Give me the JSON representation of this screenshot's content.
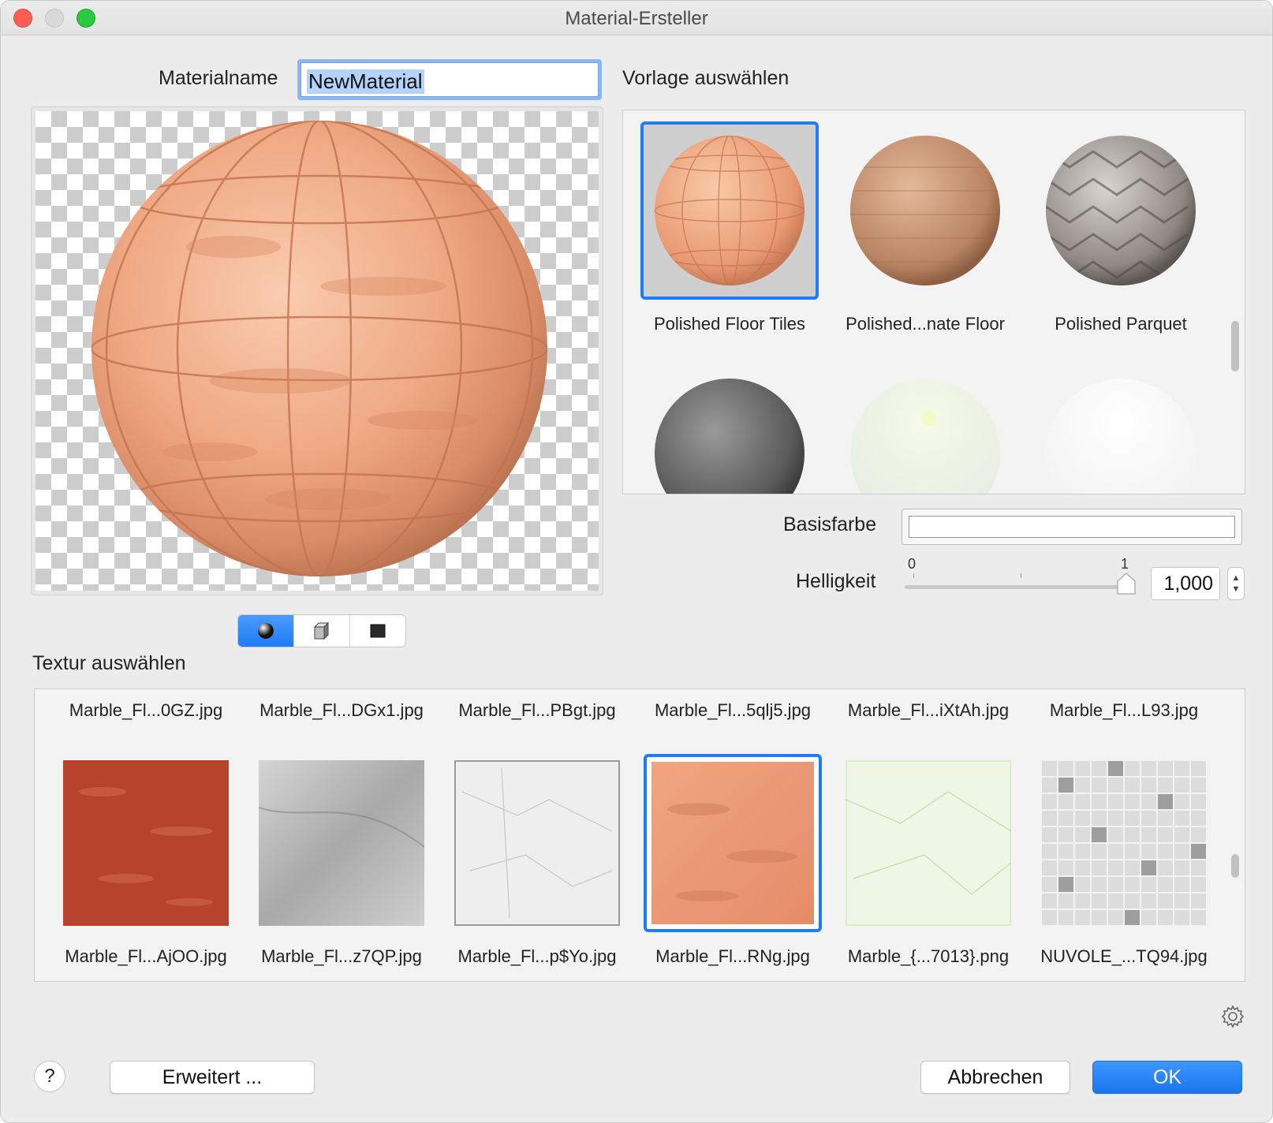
{
  "window": {
    "title": "Material-Ersteller"
  },
  "material_name": {
    "label": "Materialname",
    "value": "NewMaterial"
  },
  "template": {
    "heading": "Vorlage auswählen",
    "items": [
      {
        "label": "Polished Floor Tiles",
        "selected": true
      },
      {
        "label": "Polished...nate Floor",
        "selected": false
      },
      {
        "label": "Polished Parquet",
        "selected": false
      },
      {
        "label": "",
        "selected": false
      },
      {
        "label": "",
        "selected": false
      },
      {
        "label": "",
        "selected": false
      }
    ]
  },
  "preview_shapes": [
    "sphere-icon",
    "cube-icon",
    "plane-icon"
  ],
  "base_color": {
    "label": "Basisfarbe",
    "color": "#ffffff"
  },
  "brightness": {
    "label": "Helligkeit",
    "min_label": "0",
    "max_label": "1",
    "value": "1,000",
    "level": 1.0
  },
  "texture": {
    "heading": "Textur auswählen",
    "top_row_labels": [
      "Marble_Fl...0GZ.jpg",
      "Marble_Fl...DGx1.jpg",
      "Marble_Fl...PBgt.jpg",
      "Marble_Fl...5qlj5.jpg",
      "Marble_Fl...iXtAh.jpg",
      "Marble_Fl...L93.jpg"
    ],
    "items": [
      {
        "label": "Marble_Fl...AjOO.jpg",
        "selected": false
      },
      {
        "label": "Marble_Fl...z7QP.jpg",
        "selected": false
      },
      {
        "label": "Marble_Fl...p$Yo.jpg",
        "selected": false
      },
      {
        "label": "Marble_Fl...RNg.jpg",
        "selected": true
      },
      {
        "label": "Marble_{...7013}.png",
        "selected": false
      },
      {
        "label": "NUVOLE_...TQ94.jpg",
        "selected": false
      }
    ]
  },
  "buttons": {
    "help": "?",
    "advanced": "Erweitert ...",
    "cancel": "Abbrechen",
    "ok": "OK"
  },
  "colors": {
    "accent": "#1f7cf5"
  }
}
